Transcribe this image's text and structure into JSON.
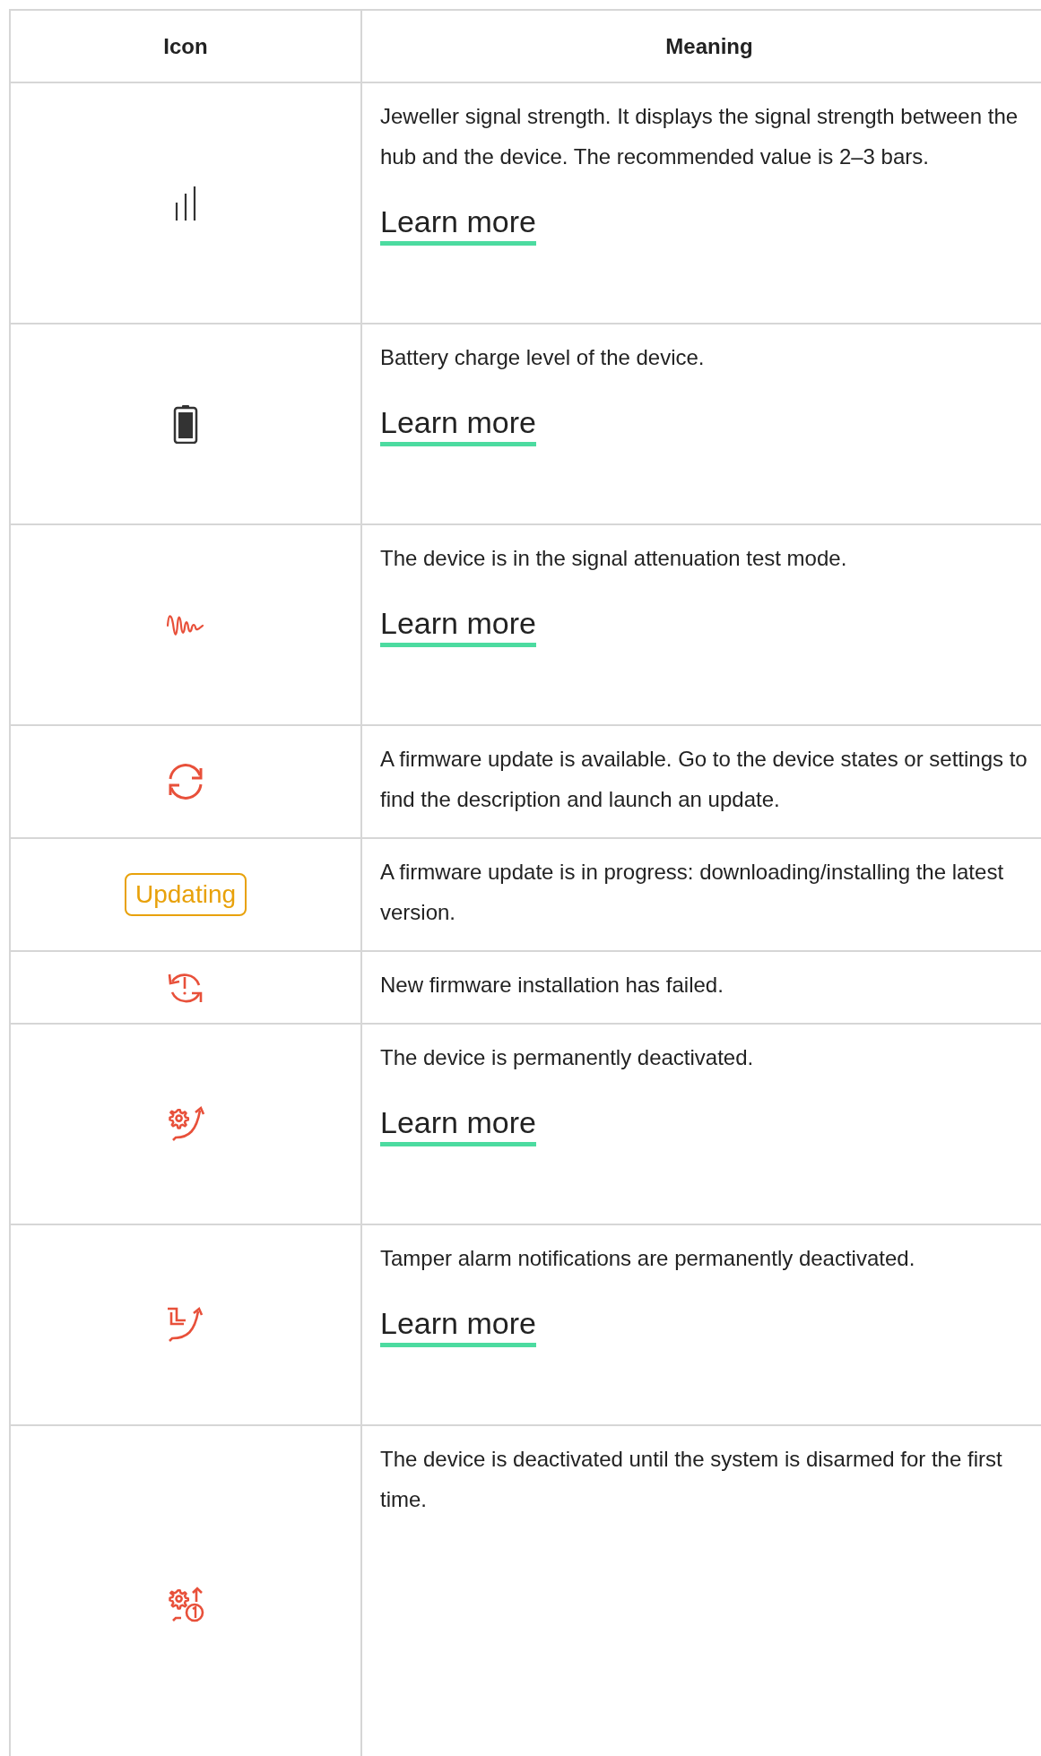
{
  "table": {
    "columns": [
      "Icon",
      "Meaning"
    ],
    "rows": [
      {
        "icon": {
          "kind": "signal"
        },
        "meaning": "Jeweller signal strength. It displays the signal strength between the hub and the device. The recommended value is 2–3 bars.",
        "link": "Learn more"
      },
      {
        "icon": {
          "kind": "battery"
        },
        "meaning": "Battery charge level of the device.",
        "link": "Learn more"
      },
      {
        "icon": {
          "kind": "attenuation"
        },
        "meaning": "The device is in the signal attenuation test mode.",
        "link": "Learn more"
      },
      {
        "icon": {
          "kind": "update"
        },
        "meaning": "A firmware update is available. Go to the device states or settings to find the description and launch an update."
      },
      {
        "icon": {
          "kind": "badge",
          "text": "Updating"
        },
        "meaning": "A firmware update is in progress: downloading/installing the latest version."
      },
      {
        "icon": {
          "kind": "update_failed"
        },
        "meaning": "New firmware installation has failed."
      },
      {
        "icon": {
          "kind": "deactivated"
        },
        "meaning": "The device is permanently deactivated.",
        "link": "Learn more"
      },
      {
        "icon": {
          "kind": "tamper_deactivated"
        },
        "meaning": "Tamper alarm notifications are permanently deactivated.",
        "link": "Learn more"
      },
      {
        "icon": {
          "kind": "deactivated_once"
        },
        "meaning": "The device is deactivated until the system is disarmed for the first time."
      }
    ]
  }
}
